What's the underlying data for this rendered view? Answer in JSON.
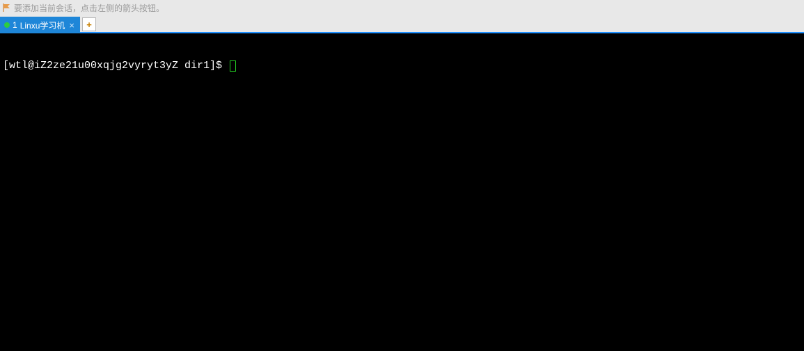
{
  "hint": {
    "text": "要添加当前会话，点击左侧的箭头按钮。"
  },
  "tabs": {
    "items": [
      {
        "index": "1",
        "label": "Linxu学习机"
      }
    ],
    "new_tab_label": "+"
  },
  "terminal": {
    "prompt": "[wtl@iZ2ze21u00xqjg2vyryt3yZ dir1]$ "
  }
}
